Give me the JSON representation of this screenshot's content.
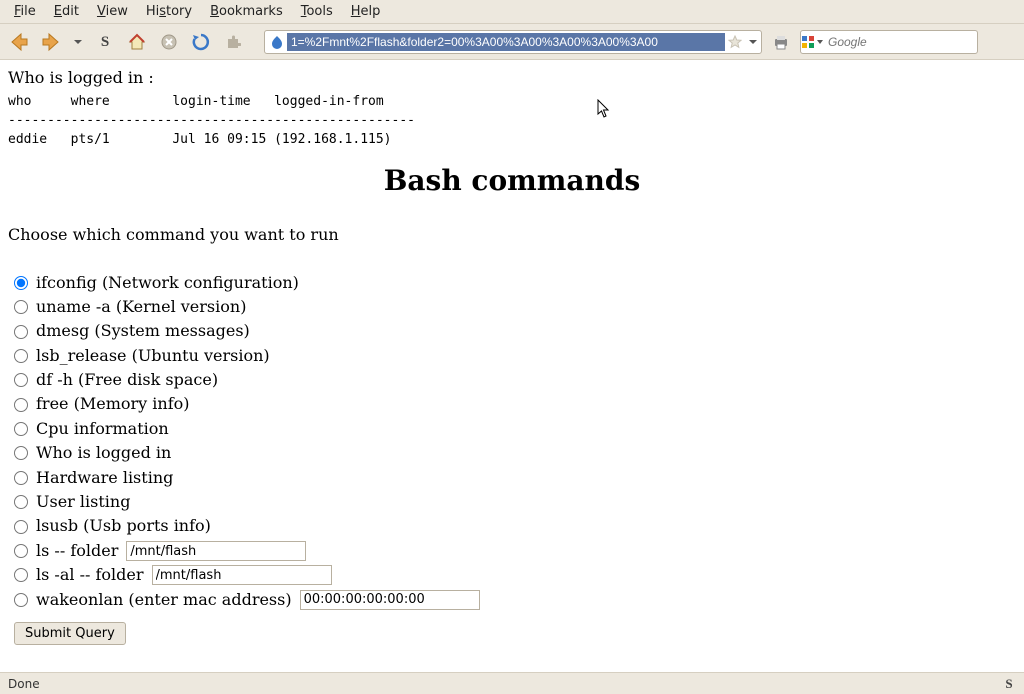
{
  "menu": {
    "items": [
      "File",
      "Edit",
      "View",
      "History",
      "Bookmarks",
      "Tools",
      "Help"
    ]
  },
  "urlbar": {
    "value": "1=%2Fmnt%2Fflash&folder2=00%3A00%3A00%3A00%3A00%3A00"
  },
  "searchbar": {
    "placeholder": "Google"
  },
  "page": {
    "who_heading": "Who is logged in :",
    "who_output": "who     where        login-time   logged-in-from\n----------------------------------------------------\neddie   pts/1        Jul 16 09:15 (192.168.1.115)",
    "title": "Bash commands",
    "choose_label": "Choose which command you want to run",
    "options": [
      {
        "label": "ifconfig (Network configuration)",
        "checked": true
      },
      {
        "label": "uname -a (Kernel version)"
      },
      {
        "label": "dmesg (System messages)"
      },
      {
        "label": "lsb_release (Ubuntu version)"
      },
      {
        "label": "df -h (Free disk space)"
      },
      {
        "label": "free (Memory info)"
      },
      {
        "label": "Cpu information"
      },
      {
        "label": "Who is logged in"
      },
      {
        "label": "Hardware listing"
      },
      {
        "label": "User listing"
      },
      {
        "label": "lsusb (Usb ports info)"
      },
      {
        "label": "ls -- folder",
        "input_value": "/mnt/flash",
        "input_width": 180
      },
      {
        "label": "ls -al -- folder",
        "input_value": "/mnt/flash",
        "input_width": 180
      },
      {
        "label": "wakeonlan (enter mac address)",
        "input_value": "00:00:00:00:00:00",
        "input_width": 180
      }
    ],
    "submit_label": "Submit Query"
  },
  "statusbar": {
    "text": "Done"
  }
}
